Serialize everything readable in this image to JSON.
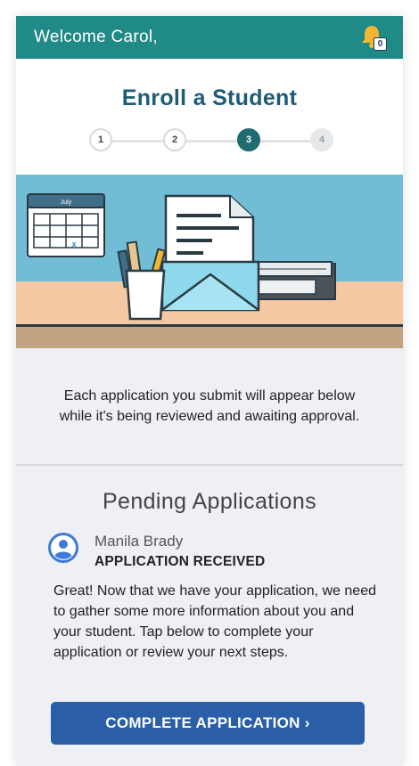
{
  "topbar": {
    "welcome": "Welcome Carol,",
    "notification_count": "0"
  },
  "header": {
    "title": "Enroll a Student",
    "steps": [
      "1",
      "2",
      "3",
      "4"
    ],
    "current_step": 3
  },
  "hero": {
    "calendar_month": "July",
    "calendar_mark": "x"
  },
  "info": {
    "text": "Each application you submit will appear below while it's being reviewed and awaiting approval."
  },
  "pending": {
    "title": "Pending Applications",
    "applications": [
      {
        "name": "Manila Brady",
        "status": "APPLICATION RECEIVED",
        "message": "Great! Now that we have your application, we need to gather some more information about you and your student. Tap below to complete your application or review your next steps."
      }
    ],
    "cta_label": "COMPLETE APPLICATION ›"
  },
  "colors": {
    "topbar": "#1f8a86",
    "title": "#1d5b79",
    "active_step": "#1f6b6f",
    "cta": "#2a5fa8",
    "hero_sky": "#72bdd6"
  }
}
